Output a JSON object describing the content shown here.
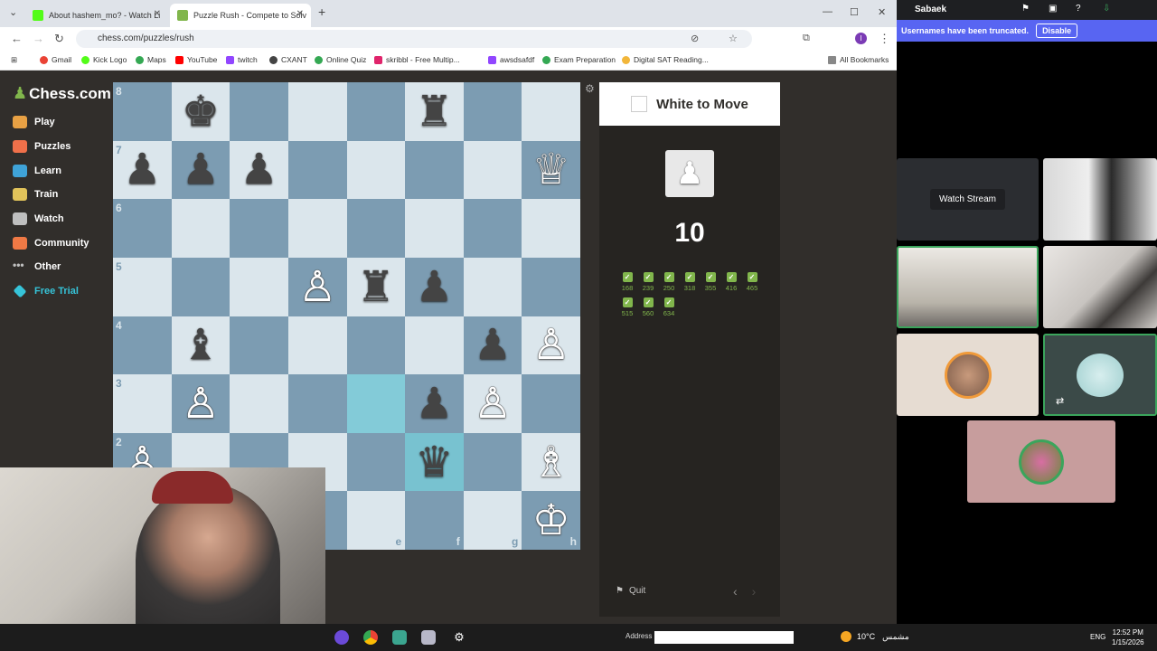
{
  "browser": {
    "tabs": [
      {
        "title": "About hashem_mo? - Watch Li"
      },
      {
        "title": "Puzzle Rush - Compete to Solv"
      }
    ],
    "url": "chess.com/puzzles/rush",
    "bookmarks": [
      "Gmail",
      "Kick Logo",
      "Maps",
      "YouTube",
      "twitch",
      "CXANT",
      "Online Quiz",
      "skribbl - Free Multip...",
      "awsdsafdf",
      "Exam Preparation",
      "Digital SAT Reading..."
    ],
    "all_bookmarks": "All Bookmarks"
  },
  "sidebar": {
    "logo": "Chess.com",
    "items": [
      {
        "label": "Play",
        "color": "#e8a144"
      },
      {
        "label": "Puzzles",
        "color": "#f0704a"
      },
      {
        "label": "Learn",
        "color": "#3fa3d8"
      },
      {
        "label": "Train",
        "color": "#e1c35a"
      },
      {
        "label": "Watch",
        "color": "#bfbfbf"
      },
      {
        "label": "Community",
        "color": "#f07945"
      },
      {
        "label": "Other",
        "color": "#bfbfbf"
      },
      {
        "label": "Free Trial",
        "color": "#36c4d9",
        "highlight": true
      }
    ]
  },
  "board": {
    "rank_labels": [
      "8",
      "7",
      "6",
      "5",
      "4",
      "3",
      "2"
    ],
    "file_labels": [
      "e",
      "f",
      "g",
      "h"
    ],
    "pieces": [
      {
        "square": "b8",
        "glyph": "♚",
        "color": "black"
      },
      {
        "square": "f8",
        "glyph": "♜",
        "color": "black"
      },
      {
        "square": "a7",
        "glyph": "♟",
        "color": "black"
      },
      {
        "square": "b7",
        "glyph": "♟",
        "color": "black"
      },
      {
        "square": "c7",
        "glyph": "♟",
        "color": "black"
      },
      {
        "square": "h7",
        "glyph": "♕",
        "color": "white"
      },
      {
        "square": "d5",
        "glyph": "♙",
        "color": "white"
      },
      {
        "square": "e5",
        "glyph": "♜",
        "color": "black"
      },
      {
        "square": "f5",
        "glyph": "♟",
        "color": "black"
      },
      {
        "square": "b4",
        "glyph": "♝",
        "color": "black"
      },
      {
        "square": "g4",
        "glyph": "♟",
        "color": "black"
      },
      {
        "square": "h4",
        "glyph": "♙",
        "color": "white"
      },
      {
        "square": "b3",
        "glyph": "♙",
        "color": "white"
      },
      {
        "square": "f3",
        "glyph": "♟",
        "color": "black"
      },
      {
        "square": "g3",
        "glyph": "♙",
        "color": "white"
      },
      {
        "square": "a2",
        "glyph": "♙",
        "color": "white"
      },
      {
        "square": "f2",
        "glyph": "♛",
        "color": "black"
      },
      {
        "square": "h2",
        "glyph": "♗",
        "color": "white"
      },
      {
        "square": "h1",
        "glyph": "♔",
        "color": "white"
      }
    ],
    "highlight_squares": [
      "e3",
      "f2"
    ]
  },
  "panel": {
    "turn": "White to Move",
    "score": "10",
    "results": [
      "168",
      "239",
      "250",
      "318",
      "355",
      "416",
      "465",
      "515",
      "560",
      "634"
    ],
    "quit": "Quit"
  },
  "discord": {
    "user": "Sabaek",
    "banner": "Usernames have been truncated.",
    "disable": "Disable",
    "watch_stream": "Watch Stream"
  },
  "taskbar": {
    "address_label": "Address",
    "weather": "10°C",
    "weather_city": "مشمس",
    "lang": "ENG",
    "time": "12:52 PM",
    "date": "1/15/2026"
  }
}
